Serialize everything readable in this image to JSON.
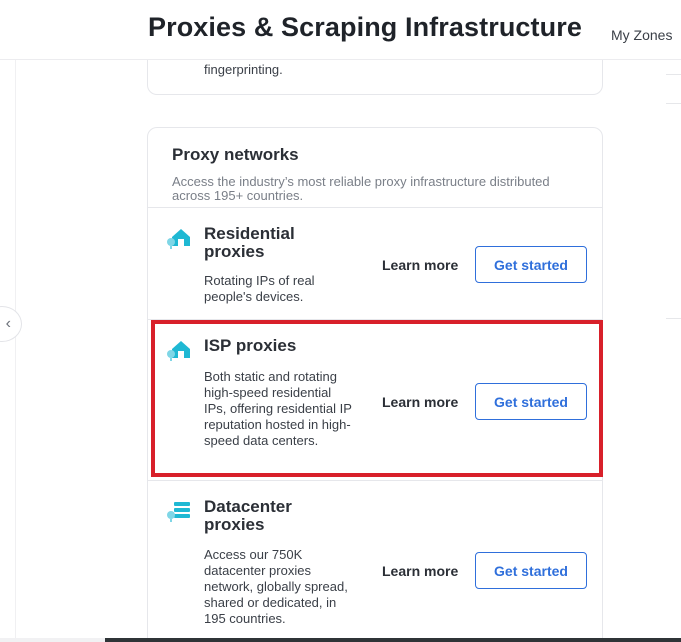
{
  "header": {
    "title": "Proxies & Scraping Infrastructure",
    "my_zones": "My Zones"
  },
  "top_card": {
    "text": "fingerprinting."
  },
  "proxy_networks": {
    "title": "Proxy networks",
    "description": "Access the industry’s most reliable proxy infrastructure distributed across 195+ countries.",
    "items": [
      {
        "title": "Residential proxies",
        "description": "Rotating IPs of real people's devices.",
        "icon": "residential-house-icon",
        "learn_more": "Learn more",
        "get_started": "Get started"
      },
      {
        "title": "ISP proxies",
        "description": "Both static and rotating high-speed residential IPs, offering residential IP reputation hosted in high-speed data centers.",
        "icon": "isp-house-icon",
        "learn_more": "Learn more",
        "get_started": "Get started"
      },
      {
        "title": "Datacenter proxies",
        "description": "Access our 750K datacenter proxies network, globally spread, shared or dedicated, in 195 countries.",
        "icon": "datacenter-server-icon",
        "learn_more": "Learn more",
        "get_started": "Get started"
      }
    ]
  },
  "colors": {
    "accent": "#2f6fdb",
    "icon_teal": "#1fb8d3",
    "highlight": "#d8202a"
  }
}
